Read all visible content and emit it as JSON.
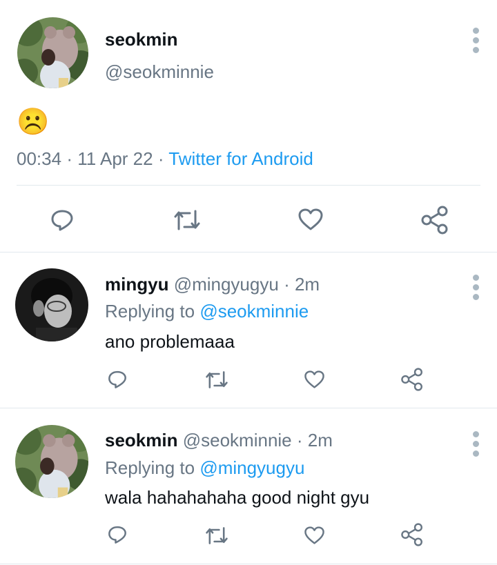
{
  "main_tweet": {
    "display_name": "seokmin",
    "handle": "@seokminnie",
    "content": "☹️",
    "time": "00:34",
    "date": "11 Apr 22",
    "source": "Twitter for Android"
  },
  "replies": [
    {
      "display_name": "mingyu",
      "handle": "@mingyugyu",
      "age": "2m",
      "replying_label": "Replying to",
      "replying_to": "@seokminnie",
      "text": "ano problemaaa"
    },
    {
      "display_name": "seokmin",
      "handle": "@seokminnie",
      "age": "2m",
      "replying_label": "Replying to",
      "replying_to": "@mingyugyu",
      "text": "wala hahahahaha good night gyu"
    }
  ],
  "separators": {
    "dot": "·"
  },
  "icons": {
    "reply": "reply-icon",
    "retweet": "retweet-icon",
    "like": "heart-icon",
    "share": "share-icon",
    "more": "more-vertical-icon"
  },
  "colors": {
    "link": "#1d9bf0",
    "secondary_text": "#687684",
    "icon": "#687684",
    "divider": "#e1e8ed"
  }
}
